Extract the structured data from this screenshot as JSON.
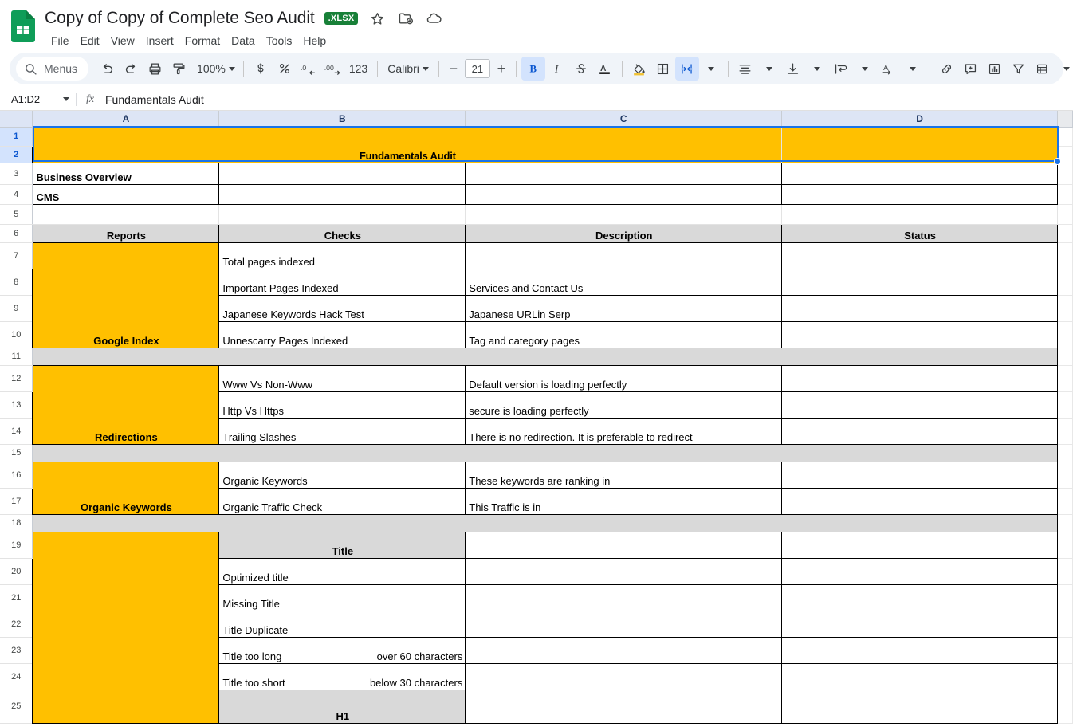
{
  "titlebar": {
    "doc_title": "Copy of Copy of Complete Seo Audit",
    "format_badge": ".XLSX",
    "icons": [
      "star-icon",
      "drive-move-icon",
      "cloud-saved-icon"
    ],
    "menus": [
      "File",
      "Edit",
      "View",
      "Insert",
      "Format",
      "Data",
      "Tools",
      "Help"
    ]
  },
  "toolbar": {
    "menus_label": "Menus",
    "zoom_level": "100%",
    "font_name": "Calibri",
    "font_size": "21",
    "number_123": "123",
    "bold_active": true,
    "merge_active": true,
    "accent": "#d3e3fd",
    "icons": [
      "search-icon",
      "undo-icon",
      "redo-icon",
      "print-icon",
      "paint-format-icon",
      "currency-icon",
      "percent-icon",
      "decrease-decimal-icon",
      "increase-decimal-icon",
      "bold-icon",
      "italic-icon",
      "strikethrough-icon",
      "text-color-icon",
      "fill-color-icon",
      "borders-icon",
      "merge-cells-icon",
      "horizontal-align-icon",
      "vertical-align-icon",
      "text-wrap-icon",
      "text-rotation-icon",
      "insert-link-icon",
      "insert-comment-icon",
      "insert-chart-icon",
      "filter-icon",
      "functions-icon",
      "sum-icon"
    ]
  },
  "formulabar": {
    "name_box": "A1:D2",
    "fx_label": "fx",
    "formula_value": "Fundamentals Audit"
  },
  "grid": {
    "columns": [
      "A",
      "B",
      "C",
      "D"
    ],
    "selected_columns": [
      "A",
      "B",
      "C",
      "D"
    ],
    "selected_rows": [
      1,
      2
    ],
    "colors": {
      "orange": "#FFC000",
      "gray": "#D9D9D9",
      "selection_blue": "#1a73e8",
      "header_blue": "#dde5f5"
    },
    "title": "Fundamentals Audit",
    "headers": {
      "a": "Reports",
      "b": "Checks",
      "c": "Description",
      "d": "Status"
    },
    "rows": [
      {
        "n": 1,
        "type": "merged-title"
      },
      {
        "n": 2,
        "type": "merged-title"
      },
      {
        "n": 3,
        "type": "data",
        "a": "Business Overview",
        "b": "",
        "c": "",
        "d": ""
      },
      {
        "n": 4,
        "type": "data",
        "a": "CMS",
        "b": "",
        "c": "",
        "d": ""
      },
      {
        "n": 5,
        "type": "blank"
      },
      {
        "n": 6,
        "type": "header"
      },
      {
        "n": 7,
        "type": "data",
        "a": "",
        "b": "Total pages indexed",
        "c": "",
        "d": ""
      },
      {
        "n": 8,
        "type": "data",
        "a": "Google Index",
        "b": "Important Pages Indexed",
        "c": "Services and Contact Us",
        "d": ""
      },
      {
        "n": 9,
        "type": "data",
        "a": "",
        "b": "Japanese Keywords Hack Test",
        "c": "Japanese URLin Serp",
        "d": ""
      },
      {
        "n": 10,
        "type": "data",
        "a": "",
        "b": "Unnescarry Pages Indexed",
        "c": "Tag and category pages",
        "d": ""
      },
      {
        "n": 11,
        "type": "separator"
      },
      {
        "n": 12,
        "type": "data",
        "a": "",
        "b": "Www Vs Non-Www",
        "c": "Default version is loading perfectly",
        "d": ""
      },
      {
        "n": 13,
        "type": "data",
        "a": "Redirections",
        "b": "Http Vs Https",
        "c": "secure is loading perfectly",
        "d": ""
      },
      {
        "n": 14,
        "type": "data",
        "a": "",
        "b": "Trailing Slashes",
        "c": "There is no redirection. It is preferable to redirect",
        "d": ""
      },
      {
        "n": 15,
        "type": "separator"
      },
      {
        "n": 16,
        "type": "data",
        "a": "Organic Keywords",
        "b": "Organic Keywords",
        "c": "These keywords are ranking in",
        "d": ""
      },
      {
        "n": 17,
        "type": "data",
        "a": "",
        "b": "Organic Traffic Check",
        "c": "This Traffic is in",
        "d": ""
      },
      {
        "n": 18,
        "type": "separator"
      },
      {
        "n": 19,
        "type": "subheader",
        "b": "Title"
      },
      {
        "n": 20,
        "type": "data",
        "a": "",
        "b": "Optimized title",
        "c": "",
        "d": ""
      },
      {
        "n": 21,
        "type": "data",
        "a": "",
        "b": "Missing Title",
        "c": "",
        "d": ""
      },
      {
        "n": 22,
        "type": "data",
        "a": "",
        "b": "Title Duplicate",
        "c": "",
        "d": ""
      },
      {
        "n": 23,
        "type": "data",
        "a": "",
        "b": "Title too long",
        "b2": "over 60 characters",
        "c": "",
        "d": ""
      },
      {
        "n": 24,
        "type": "data",
        "a": "",
        "b": "Title too short",
        "b2": "below 30 characters",
        "c": "",
        "d": ""
      },
      {
        "n": 25,
        "type": "subheader",
        "b": "H1"
      }
    ],
    "sections": [
      {
        "label": "Google Index",
        "rows": [
          7,
          10
        ]
      },
      {
        "label": "Redirections",
        "rows": [
          12,
          14
        ]
      },
      {
        "label": "Organic Keywords",
        "rows": [
          16,
          17
        ]
      }
    ]
  }
}
